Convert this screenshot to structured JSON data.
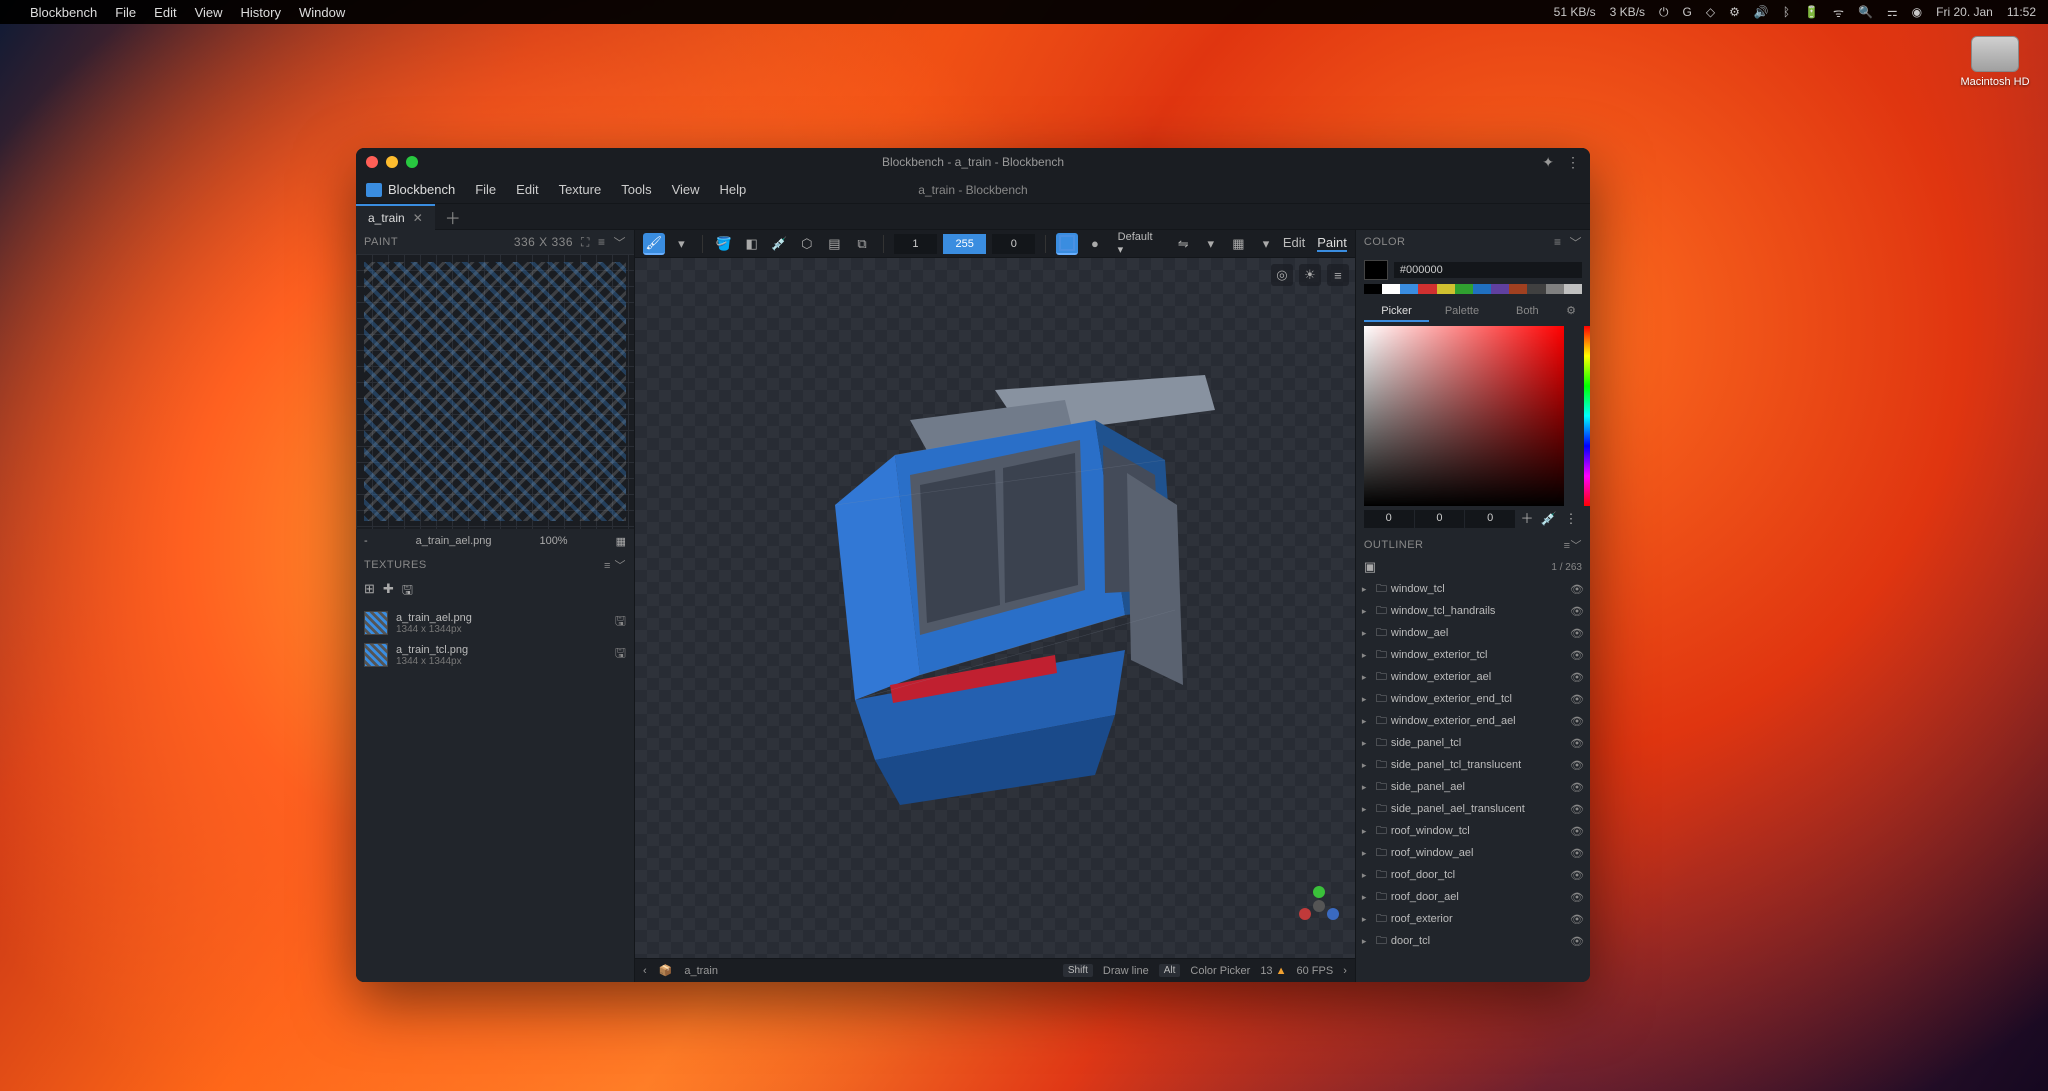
{
  "macbar": {
    "app": "Blockbench",
    "items": [
      "File",
      "Edit",
      "View",
      "History",
      "Window"
    ],
    "net_down": "51 KB/s",
    "net_up": "3 KB/s",
    "date": "Fri 20. Jan",
    "time": "11:52"
  },
  "desktop": {
    "hd": "Macintosh HD"
  },
  "window": {
    "title": "Blockbench - a_train - Blockbench",
    "subtitle": "a_train - Blockbench",
    "app": "Blockbench",
    "menu": [
      "File",
      "Edit",
      "Texture",
      "Tools",
      "View",
      "Help"
    ],
    "tab": "a_train"
  },
  "paint": {
    "title": "PAINT",
    "resolution": "336 X 336",
    "uv_file": "a_train_ael.png",
    "uv_zoom": "100%"
  },
  "textures": {
    "title": "TEXTURES",
    "items": [
      {
        "name": "a_train_ael.png",
        "dims": "1344 x 1344px"
      },
      {
        "name": "a_train_tcl.png",
        "dims": "1344 x 1344px"
      }
    ]
  },
  "toolbar": {
    "val1": "1",
    "val2": "255",
    "val3": "0",
    "mode": "Default ▾",
    "modes": {
      "edit": "Edit",
      "paint": "Paint"
    }
  },
  "statusbar": {
    "project": "a_train",
    "hint1_key": "Shift",
    "hint1_txt": "Draw line",
    "hint2_key": "Alt",
    "hint2_txt": "Color Picker",
    "warn_count": "13",
    "fps": "60 FPS"
  },
  "color": {
    "title": "COLOR",
    "hex": "#000000",
    "tabs": [
      "Picker",
      "Palette",
      "Both"
    ],
    "r": "0",
    "g": "0",
    "b": "0",
    "palette": [
      "#000000",
      "#ffffff",
      "#3a8de0",
      "#d03030",
      "#d0c030",
      "#30a030",
      "#2070c0",
      "#6040a0",
      "#a04020",
      "#404040",
      "#808080",
      "#c0c0c0"
    ]
  },
  "outliner": {
    "title": "OUTLINER",
    "count": "1 / 263",
    "nodes": [
      "window_tcl",
      "window_tcl_handrails",
      "window_ael",
      "window_exterior_tcl",
      "window_exterior_ael",
      "window_exterior_end_tcl",
      "window_exterior_end_ael",
      "side_panel_tcl",
      "side_panel_tcl_translucent",
      "side_panel_ael",
      "side_panel_ael_translucent",
      "roof_window_tcl",
      "roof_window_ael",
      "roof_door_tcl",
      "roof_door_ael",
      "roof_exterior",
      "door_tcl"
    ]
  }
}
